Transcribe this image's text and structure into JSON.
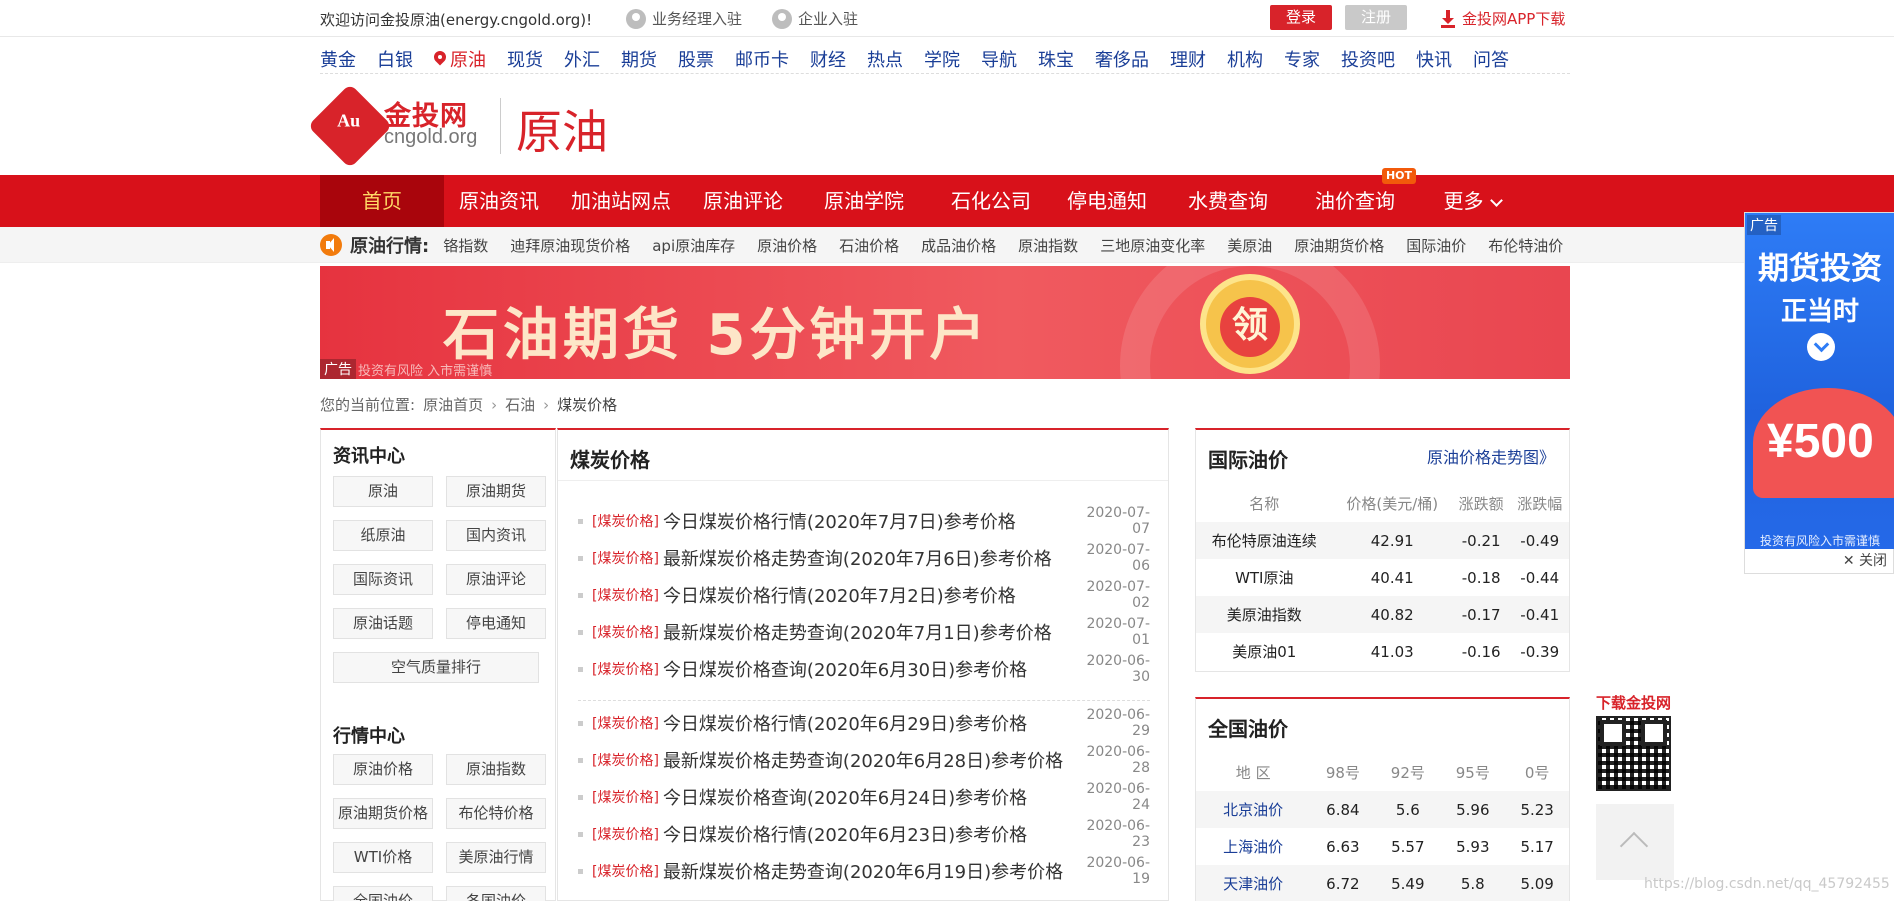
{
  "topbar": {
    "welcome": "欢迎访问金投原油(energy.cngold.org)!",
    "manager_entry": "业务经理入驻",
    "company_entry": "企业入驻",
    "login": "登录",
    "register": "注册",
    "app_download": "金投网APP下载"
  },
  "channels": [
    "黄金",
    "白银",
    "原油",
    "现货",
    "外汇",
    "期货",
    "股票",
    "邮币卡",
    "财经",
    "热点",
    "学院",
    "导航",
    "珠宝",
    "奢侈品",
    "理财",
    "机构",
    "专家",
    "投资吧",
    "快讯",
    "问答"
  ],
  "active_channel": "原油",
  "logo": {
    "cn": "金投网",
    "en": "cngold.org",
    "mark": "Au"
  },
  "site_name": "原油",
  "nav": {
    "items": [
      "首页",
      "原油资讯",
      "加油站网点",
      "原油评论",
      "原油学院",
      "石化公司",
      "停电通知",
      "水费查询",
      "油价查询",
      "更多"
    ],
    "hot_badge": "HOT"
  },
  "quotes": {
    "label": "原油行情:",
    "items": [
      "铬指数",
      "迪拜原油现货价格",
      "api原油库存",
      "原油价格",
      "石油价格",
      "成品油价格",
      "原油指数",
      "三地原油变化率",
      "美原油",
      "原油期货价格",
      "国际油价",
      "布伦特油价"
    ]
  },
  "banner": {
    "text": "石油期货 5分钟开户",
    "coin": "领",
    "ad_tag": "广告",
    "risk": "投资有风险 入市需谨慎"
  },
  "breadcrumb": {
    "prefix": "您的当前位置:",
    "home": "原油首页",
    "level2": "石油",
    "current": "煤炭价格"
  },
  "sidebar": {
    "news_title": "资讯中心",
    "news_tags": [
      "原油",
      "原油期货",
      "纸原油",
      "国内资讯",
      "国际资讯",
      "原油评论",
      "原油话题",
      "停电通知",
      "空气质量排行"
    ],
    "market_title": "行情中心",
    "market_tags": [
      "原油价格",
      "原油指数",
      "原油期货价格",
      "布伦特价格",
      "WTI价格",
      "美原油行情",
      "全国油价",
      "各国油价"
    ]
  },
  "main": {
    "title": "煤炭价格",
    "category": "[煤炭价格]",
    "articles": [
      {
        "title": "今日煤炭价格行情(2020年7月7日)参考价格",
        "date": "2020-07-07"
      },
      {
        "title": "最新煤炭价格走势查询(2020年7月6日)参考价格",
        "date": "2020-07-06"
      },
      {
        "title": "今日煤炭价格行情(2020年7月2日)参考价格",
        "date": "2020-07-02"
      },
      {
        "title": "最新煤炭价格走势查询(2020年7月1日)参考价格",
        "date": "2020-07-01"
      },
      {
        "title": "今日煤炭价格查询(2020年6月30日)参考价格",
        "date": "2020-06-30"
      },
      {
        "title": "今日煤炭价格行情(2020年6月29日)参考价格",
        "date": "2020-06-29"
      },
      {
        "title": "最新煤炭价格走势查询(2020年6月28日)参考价格",
        "date": "2020-06-28"
      },
      {
        "title": "今日煤炭价格查询(2020年6月24日)参考价格",
        "date": "2020-06-24"
      },
      {
        "title": "今日煤炭价格行情(2020年6月23日)参考价格",
        "date": "2020-06-23"
      },
      {
        "title": "最新煤炭价格走势查询(2020年6月19日)参考价格",
        "date": "2020-06-19"
      }
    ]
  },
  "intl_oil": {
    "title": "国际油价",
    "more": "原油价格走势图》",
    "headers": [
      "名称",
      "价格(美元/桶)",
      "涨跌额",
      "涨跌幅"
    ],
    "rows": [
      [
        "布伦特原油连续",
        "42.91",
        "-0.21",
        "-0.49"
      ],
      [
        "WTI原油",
        "40.41",
        "-0.18",
        "-0.44"
      ],
      [
        "美原油指数",
        "40.82",
        "-0.17",
        "-0.41"
      ],
      [
        "美原油01",
        "41.03",
        "-0.16",
        "-0.39"
      ]
    ]
  },
  "national_oil": {
    "title": "全国油价",
    "headers": [
      "地 区",
      "98号",
      "92号",
      "95号",
      "0号"
    ],
    "rows": [
      [
        "北京油价",
        "6.84",
        "5.6",
        "5.96",
        "5.23"
      ],
      [
        "上海油价",
        "6.63",
        "5.57",
        "5.93",
        "5.17"
      ],
      [
        "天津油价",
        "6.72",
        "5.49",
        "5.8",
        "5.09"
      ]
    ]
  },
  "side_ad": {
    "ad_tag": "广告",
    "line1": "期货投资",
    "line2": "正当时",
    "amount": "¥500",
    "risk": "投资有风险入市需谨慎",
    "close": "✕ 关闭"
  },
  "download": {
    "label": "下载金投网"
  },
  "watermark": "https://blog.csdn.net/qq_45792455",
  "colors": {
    "brand_red": "#d8232a",
    "link_blue": "#1a3e97",
    "nav_red": "#d8111a"
  }
}
